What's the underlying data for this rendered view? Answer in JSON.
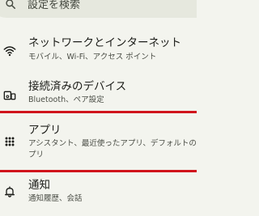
{
  "search": {
    "placeholder": "設定を検索",
    "icon": "search-icon"
  },
  "settings": {
    "items": [
      {
        "title": "ネットワークとインターネット",
        "subtitle": "モバイル、Wi-Fi、アクセス ポイント",
        "icon": "wifi-icon"
      },
      {
        "title": "接続済みのデバイス",
        "subtitle": "Bluetooth、ペア設定",
        "icon": "connected-devices-icon"
      },
      {
        "title": "アプリ",
        "subtitle_line1": "アシスタント、最近使ったアプリ、デフォルトのア",
        "subtitle_line2": "プリ",
        "icon": "apps-grid-icon"
      },
      {
        "title": "通知",
        "subtitle": "通知履歴、会話",
        "icon": "bell-icon"
      }
    ]
  },
  "colors": {
    "background": "#f3f4ee",
    "highlight": "#d0141c",
    "search_bar": "#e6e8de"
  }
}
